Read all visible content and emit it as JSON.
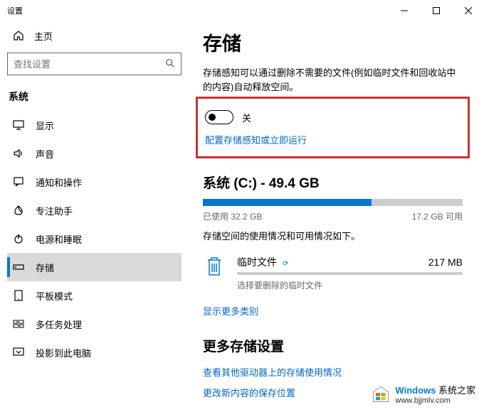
{
  "window": {
    "title": "设置"
  },
  "sidebar": {
    "home_label": "主页",
    "search_placeholder": "查找设置",
    "section_label": "系统",
    "items": [
      {
        "label": "显示"
      },
      {
        "label": "声音"
      },
      {
        "label": "通知和操作"
      },
      {
        "label": "专注助手"
      },
      {
        "label": "电源和睡眠"
      },
      {
        "label": "存储"
      },
      {
        "label": "平板模式"
      },
      {
        "label": "多任务处理"
      },
      {
        "label": "投影到此电脑"
      }
    ]
  },
  "main": {
    "title": "存储",
    "description": "存储感知可以通过删除不需要的文件(例如临时文件和回收站中的内容)自动释放空间。",
    "toggle_state": "关",
    "configure_link": "配置存储感知或立即运行",
    "drive": {
      "title": "系统 (C:) - 49.4 GB",
      "used_label": "已使用 32.2 GB",
      "free_label": "17.2 GB 可用",
      "info": "存储空间的使用情况和可用情况如下。"
    },
    "category": {
      "name": "临时文件",
      "size": "217 MB",
      "sub": "选择要删除的临时文件"
    },
    "show_more": "显示更多类别",
    "more_section": "更多存储设置",
    "more_links": [
      "查看其他驱动器上的存储使用情况",
      "更改新内容的保存位置"
    ]
  },
  "watermark": {
    "brand": "Windows",
    "sub1": "系统之家",
    "url": "www.bjjmlv.com"
  }
}
